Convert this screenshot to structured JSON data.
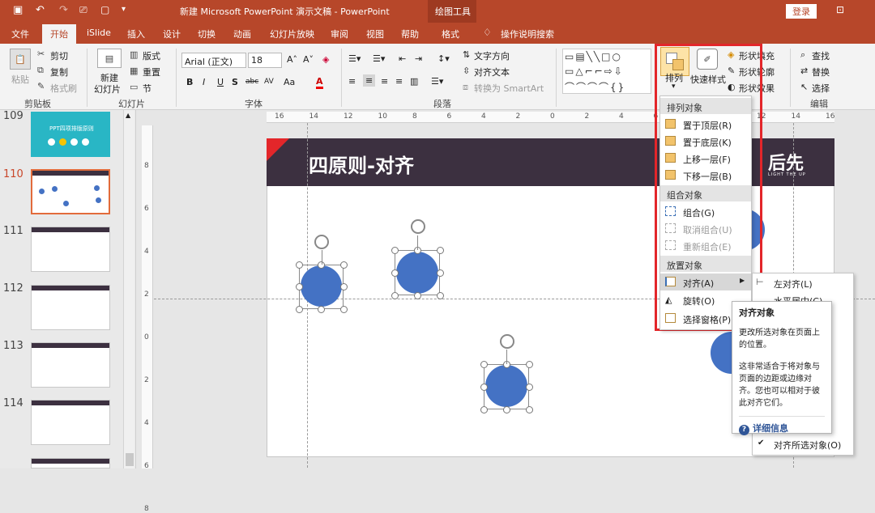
{
  "titlebar": {
    "title": "新建 Microsoft PowerPoint 演示文稿  -  PowerPoint",
    "context_tool": "绘图工具",
    "login_label": "登录"
  },
  "tabs": [
    "文件",
    "开始",
    "iSlide",
    "插入",
    "设计",
    "切换",
    "动画",
    "幻灯片放映",
    "审阅",
    "视图",
    "帮助",
    "格式"
  ],
  "active_tab": "开始",
  "tell_me": "操作说明搜索",
  "ribbon": {
    "clipboard": {
      "paste": "粘贴",
      "cut": "剪切",
      "copy": "复制",
      "format_painter": "格式刷",
      "group": "剪贴板"
    },
    "slides": {
      "new_slide_line1": "新建",
      "new_slide_line2": "幻灯片",
      "layout": "版式",
      "reset": "重置",
      "section": "节",
      "group": "幻灯片"
    },
    "font": {
      "font_name": "Arial (正文)",
      "font_size": "18",
      "bold": "B",
      "italic": "I",
      "underline": "U",
      "shadow": "S",
      "strike": "abc",
      "spacing": "AV",
      "case": "Aa",
      "color": "A",
      "group": "字体"
    },
    "paragraph": {
      "text_direction": "文字方向",
      "align_text": "对齐文本",
      "convert_smartart": "转换为 SmartArt",
      "group": "段落"
    },
    "drawing": {
      "arrange": "排列",
      "quick_styles": "快速样式",
      "shape_fill": "形状填充",
      "shape_outline": "形状轮廓",
      "shape_effects": "形状效果"
    },
    "editing": {
      "find": "查找",
      "replace": "替换",
      "select": "选择",
      "group": "编辑"
    }
  },
  "rulers": {
    "h_ticks": [
      "16",
      "14",
      "12",
      "10",
      "8",
      "6",
      "4",
      "2",
      "0",
      "2",
      "4",
      "6",
      "8",
      "10",
      "12",
      "14",
      "16"
    ],
    "v_ticks": [
      "8",
      "6",
      "4",
      "2",
      "0",
      "2",
      "4",
      "6",
      "8"
    ]
  },
  "slides": [
    {
      "number": "109",
      "thumb_text": "PPT四项排版原则"
    },
    {
      "number": "110"
    },
    {
      "number": "111"
    },
    {
      "number": "112"
    },
    {
      "number": "113"
    },
    {
      "number": "114"
    }
  ],
  "current_slide": {
    "title": "四原则-对齐",
    "logo_text": "LIGHT THE UP"
  },
  "arrange_menu": {
    "section_order": "排列对象",
    "bring_to_front": "置于顶层(R)",
    "send_to_back": "置于底层(K)",
    "bring_forward": "上移一层(F)",
    "send_backward": "下移一层(B)",
    "section_group": "组合对象",
    "group": "组合(G)",
    "ungroup": "取消组合(U)",
    "regroup": "重新组合(E)",
    "section_position": "放置对象",
    "align": "对齐(A)",
    "rotate": "旋转(O)",
    "selection_pane": "选择窗格(P)..."
  },
  "align_submenu": {
    "align_left": "左对齐(L)",
    "align_center": "水平居中(C)",
    "align_selected": "对齐所选对象(O)"
  },
  "tooltip": {
    "title": "对齐对象",
    "body1": "更改所选对象在页面上的位置。",
    "body2": "这非常适合于将对象与页面的边距或边缘对齐。您也可以相对于彼此对齐它们。",
    "more_info": "详细信息"
  },
  "colors": {
    "accent": "#b7472a",
    "circle": "#4472c4",
    "slide_header": "#3c3040",
    "highlight_box": "#e3262a"
  }
}
